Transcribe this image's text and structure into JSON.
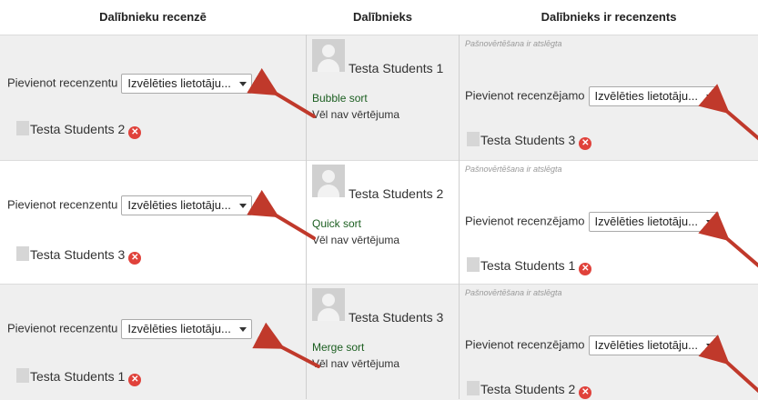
{
  "headers": {
    "peer_review": "Dalībnieku recenzē",
    "participant": "Dalībnieks",
    "participant_reviewer": "Dalībnieks ir recenzents"
  },
  "rows": [
    {
      "add_reviewer_label": "Pievienot recenzentu",
      "reviewer_select": "Izvēlēties lietotāju...",
      "reviewer": "Testa Students 2",
      "participant": "Testa Students 1",
      "submission": "Bubble sort",
      "status": "Vēl nav vērtējuma",
      "self_assessment_note": "Pašnovērtēšana ir atslēgta",
      "add_reviewee_label": "Pievienot recenzējamo",
      "reviewee_select": "Izvēlēties lietotāju...",
      "reviewee": "Testa Students 3"
    },
    {
      "add_reviewer_label": "Pievienot recenzentu",
      "reviewer_select": "Izvēlēties lietotāju...",
      "reviewer": "Testa Students 3",
      "participant": "Testa Students 2",
      "submission": "Quick sort",
      "status": "Vēl nav vērtējuma",
      "self_assessment_note": "Pašnovērtēšana ir atslēgta",
      "add_reviewee_label": "Pievienot recenzējamo",
      "reviewee_select": "Izvēlēties lietotāju...",
      "reviewee": "Testa Students 1"
    },
    {
      "add_reviewer_label": "Pievienot recenzentu",
      "reviewer_select": "Izvēlēties lietotāju...",
      "reviewer": "Testa Students 1",
      "participant": "Testa Students 3",
      "submission": "Merge sort",
      "status": "Vēl nav vērtējuma",
      "self_assessment_note": "Pašnovērtēšana ir atslēgta",
      "add_reviewee_label": "Pievienot recenzējamo",
      "reviewee_select": "Izvēlēties lietotāju...",
      "reviewee": "Testa Students 2"
    }
  ],
  "icons": {
    "remove": "remove-icon",
    "avatar": "user-avatar-icon",
    "annotation": "red-arrow-annotation"
  },
  "colors": {
    "row_bg": "#efefef",
    "submission_link": "#1b5e20",
    "remove_icon": "#e0423b",
    "arrow": "#c0392b"
  }
}
